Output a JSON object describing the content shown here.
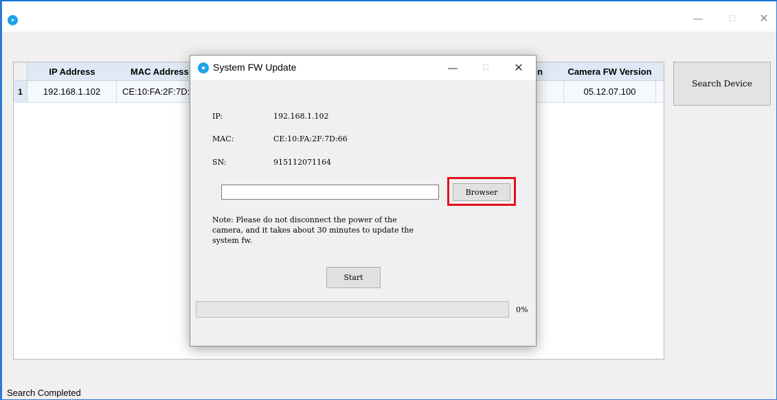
{
  "window": {
    "controls": {
      "minimize": "—",
      "maximize": "☐",
      "close": "✕"
    }
  },
  "table": {
    "columns": {
      "ip": "IP Address",
      "mac": "MAC Address",
      "hidden_partial": "n",
      "fw": "Camera FW Version"
    },
    "rows": [
      {
        "index": "1",
        "ip": "192.168.1.102",
        "mac": "CE:10:FA:2F:7D:6",
        "fw": "05.12.07.100"
      }
    ]
  },
  "search_button": "Search Device",
  "status": "Search Completed",
  "dialog": {
    "title": "System FW Update",
    "controls": {
      "minimize": "—",
      "maximize": "☐",
      "close": "✕"
    },
    "ip_label": "IP:",
    "ip_value": "192.168.1.102",
    "mac_label": "MAC:",
    "mac_value": "CE:10:FA:2F:7D:66",
    "sn_label": "SN:",
    "sn_value": "915112071164",
    "file_path": "",
    "browse_button": "Browser",
    "note": "Note: Please do not disconnect the power of the\ncamera, and it takes about 30 minutes to update the\nsystem fw.",
    "start_button": "Start",
    "progress": 0,
    "progress_text": "0%",
    "highlight_color": "#e3101c"
  },
  "colors": {
    "accent": "#1a73d9",
    "logo": "#1aa4e8",
    "header": "#dfe9f5"
  }
}
